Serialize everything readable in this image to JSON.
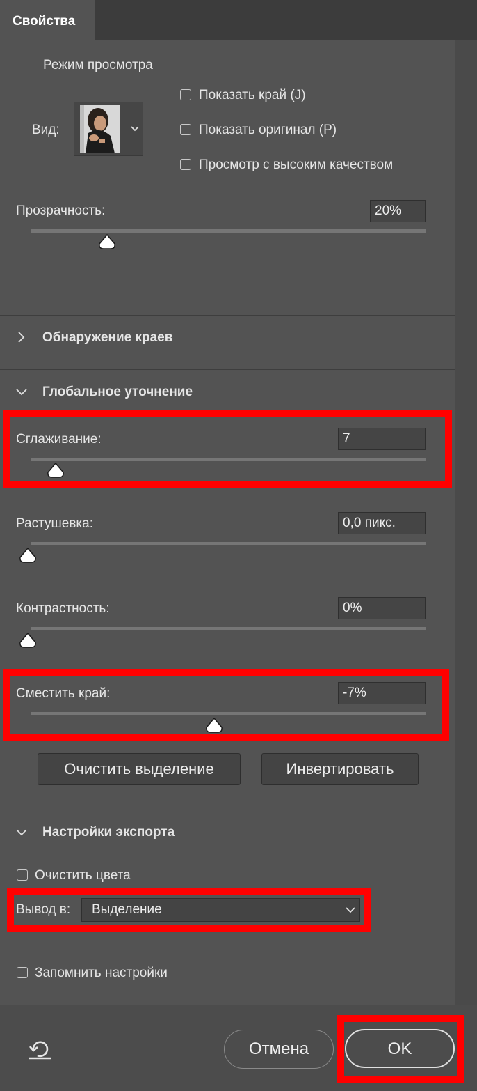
{
  "tabs": [
    {
      "label": "Свойства"
    }
  ],
  "view_mode": {
    "legend": "Режим просмотра",
    "view_label": "Вид:",
    "options": [
      {
        "label": "Показать край (J)",
        "checked": false
      },
      {
        "label": "Показать оригинал (P)",
        "checked": false
      },
      {
        "label": "Просмотр с высоким качеством",
        "checked": false
      }
    ],
    "transparency": {
      "label": "Прозрачность:",
      "value": "20%",
      "level": 0.2
    }
  },
  "sections": {
    "edge_detection": {
      "label": "Обнаружение краев",
      "expanded": false
    },
    "global_refinement": {
      "label": "Глобальное уточнение",
      "expanded": true
    },
    "export_settings": {
      "label": "Настройки экспорта",
      "expanded": true
    }
  },
  "sliders": {
    "smooth": {
      "label": "Сглаживание:",
      "value": "7",
      "level": 0.064
    },
    "feather": {
      "label": "Растушевка:",
      "value": "0,0 пикс.",
      "level": 0.0
    },
    "contrast": {
      "label": "Контрастность:",
      "value": "0%",
      "level": 0.0
    },
    "shift_edge": {
      "label": "Сместить край:",
      "value": "-7%",
      "level": 0.465
    }
  },
  "buttons": {
    "clear_selection": "Очистить выделение",
    "invert": "Инвертировать",
    "cancel": "Отмена",
    "ok": "OK"
  },
  "export": {
    "decontaminate": {
      "label": "Очистить цвета",
      "checked": false
    },
    "output_label": "Вывод в:",
    "output_value": "Выделение",
    "remember": {
      "label": "Запомнить настройки",
      "checked": false
    }
  },
  "icons": {
    "reset": "reset-icon",
    "chevron_down": "chevron-down-icon",
    "chevron_right": "chevron-right-icon",
    "slider_thumb": "slider-thumb-icon"
  },
  "colors": {
    "panel": "#535353",
    "highlight": "#ff0000",
    "text": "#e6e6e6"
  }
}
